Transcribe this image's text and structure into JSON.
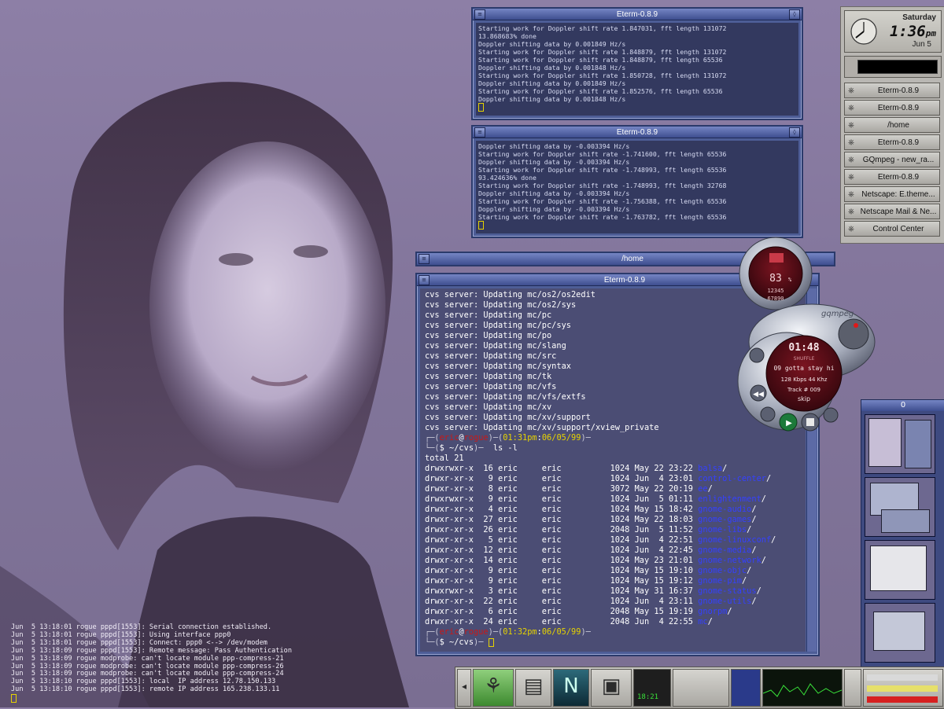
{
  "windows": {
    "eterm_top": {
      "title": "Eterm-0.8.9",
      "lines": [
        "Starting work for Doppler shift rate 1.847031, fft length 131072",
        "13.868683% done",
        "Doppler shifting data by 0.001849 Hz/s",
        "Starting work for Doppler shift rate 1.848879, fft length 131072",
        "Starting work for Doppler shift rate 1.848879, fft length 65536",
        "Doppler shifting data by 0.001848 Hz/s",
        "Starting work for Doppler shift rate 1.850728, fft length 131072",
        "Doppler shifting data by 0.001849 Hz/s",
        "Starting work for Doppler shift rate 1.852576, fft length 65536",
        "Doppler shifting data by 0.001848 Hz/s"
      ]
    },
    "eterm_mid": {
      "title": "Eterm-0.8.9",
      "lines": [
        "Doppler shifting data by -0.003394 Hz/s",
        "Starting work for Doppler shift rate -1.741600, fft length 65536",
        "Doppler shifting data by -0.003394 Hz/s",
        "Starting work for Doppler shift rate -1.748993, fft length 65536",
        "93.424636% done",
        "Starting work for Doppler shift rate -1.748993, fft length 32768",
        "Doppler shifting data by -0.003394 Hz/s",
        "Starting work for Doppler shift rate -1.756388, fft length 65536",
        "Doppler shifting data by -0.003394 Hz/s",
        "Starting work for Doppler shift rate -1.763782, fft length 65536"
      ]
    },
    "home_bar": {
      "title": "/home"
    },
    "eterm_main": {
      "title": "Eterm-0.8.9",
      "cvs_lines": [
        "cvs server: Updating mc/os2/os2edit",
        "cvs server: Updating mc/os2/sys",
        "cvs server: Updating mc/pc",
        "cvs server: Updating mc/pc/sys",
        "cvs server: Updating mc/po",
        "cvs server: Updating mc/slang",
        "cvs server: Updating mc/src",
        "cvs server: Updating mc/syntax",
        "cvs server: Updating mc/tk",
        "cvs server: Updating mc/vfs",
        "cvs server: Updating mc/vfs/extfs",
        "cvs server: Updating mc/xv",
        "cvs server: Updating mc/xv/support",
        "cvs server: Updating mc/xv/support/xview_private"
      ],
      "prompt1": {
        "user": "eric",
        "host": "rogue",
        "time": "01:31pm",
        "date": "06/05/99",
        "dir": "~/cvs",
        "cmd": "ls -l"
      },
      "total": "total 21",
      "listing": [
        {
          "perm": "drwxrwxr-x",
          "n": "16",
          "u": "eric",
          "g": "eric",
          "size": "1024",
          "date": "May 22 23:22",
          "name": "balsa"
        },
        {
          "perm": "drwxr-xr-x",
          "n": "9",
          "u": "eric",
          "g": "eric",
          "size": "1024",
          "date": "Jun  4 23:01",
          "name": "control-center"
        },
        {
          "perm": "drwxr-xr-x",
          "n": "8",
          "u": "eric",
          "g": "eric",
          "size": "3072",
          "date": "May 22 20:19",
          "name": "ee"
        },
        {
          "perm": "drwxrwxr-x",
          "n": "9",
          "u": "eric",
          "g": "eric",
          "size": "1024",
          "date": "Jun  5 01:11",
          "name": "enlightenment"
        },
        {
          "perm": "drwxr-xr-x",
          "n": "4",
          "u": "eric",
          "g": "eric",
          "size": "1024",
          "date": "May 15 18:42",
          "name": "gnome-audio"
        },
        {
          "perm": "drwxr-xr-x",
          "n": "27",
          "u": "eric",
          "g": "eric",
          "size": "1024",
          "date": "May 22 18:03",
          "name": "gnome-games"
        },
        {
          "perm": "drwxr-xr-x",
          "n": "26",
          "u": "eric",
          "g": "eric",
          "size": "2048",
          "date": "Jun  5 11:52",
          "name": "gnome-libs"
        },
        {
          "perm": "drwxr-xr-x",
          "n": "5",
          "u": "eric",
          "g": "eric",
          "size": "1024",
          "date": "Jun  4 22:51",
          "name": "gnome-linuxconf"
        },
        {
          "perm": "drwxr-xr-x",
          "n": "12",
          "u": "eric",
          "g": "eric",
          "size": "1024",
          "date": "Jun  4 22:45",
          "name": "gnome-media"
        },
        {
          "perm": "drwxr-xr-x",
          "n": "14",
          "u": "eric",
          "g": "eric",
          "size": "1024",
          "date": "May 23 21:01",
          "name": "gnome-network"
        },
        {
          "perm": "drwxr-xr-x",
          "n": "9",
          "u": "eric",
          "g": "eric",
          "size": "1024",
          "date": "May 15 19:10",
          "name": "gnome-objc"
        },
        {
          "perm": "drwxr-xr-x",
          "n": "9",
          "u": "eric",
          "g": "eric",
          "size": "1024",
          "date": "May 15 19:12",
          "name": "gnome-pim"
        },
        {
          "perm": "drwxrwxr-x",
          "n": "3",
          "u": "eric",
          "g": "eric",
          "size": "1024",
          "date": "May 31 16:37",
          "name": "gnome-status"
        },
        {
          "perm": "drwxr-xr-x",
          "n": "22",
          "u": "eric",
          "g": "eric",
          "size": "1024",
          "date": "Jun  4 23:11",
          "name": "gnome-utils"
        },
        {
          "perm": "drwxr-xr-x",
          "n": "6",
          "u": "eric",
          "g": "eric",
          "size": "2048",
          "date": "May 15 19:19",
          "name": "gnorpm"
        },
        {
          "perm": "drwxr-xr-x",
          "n": "24",
          "u": "eric",
          "g": "eric",
          "size": "2048",
          "date": "Jun  4 22:55",
          "name": "mc"
        }
      ],
      "prompt2": {
        "user": "eric",
        "host": "rogue",
        "time": "01:32pm",
        "date": "06/05/99",
        "dir": "~/cvs"
      }
    }
  },
  "syslog": [
    "Jun  5 13:18:01 rogue pppd[1553]: Serial connection established.",
    "Jun  5 13:18:01 rogue pppd[1553]: Using interface ppp0",
    "Jun  5 13:18:01 rogue pppd[1553]: Connect: ppp0 <--> /dev/modem",
    "Jun  5 13:18:09 rogue pppd[1553]: Remote message: Pass Authentication",
    "Jun  5 13:18:09 rogue modprobe: can't locate module ppp-compress-21",
    "Jun  5 13:18:09 rogue modprobe: can't locate module ppp-compress-26",
    "Jun  5 13:18:09 rogue modprobe: can't locate module ppp-compress-24",
    "Jun  5 13:18:10 rogue pppd[1553]: local  IP address 12.78.150.133",
    "Jun  5 13:18:10 rogue pppd[1553]: remote IP address 165.238.133.11"
  ],
  "clock": {
    "day": "Saturday",
    "time": "1:36",
    "ampm": "pm",
    "date": "Jun 5"
  },
  "tasks": [
    {
      "label": "Eterm-0.8.9"
    },
    {
      "label": "Eterm-0.8.9"
    },
    {
      "label": "/home"
    },
    {
      "label": "Eterm-0.8.9"
    },
    {
      "label": "GQmpeg - new_ra..."
    },
    {
      "label": "Eterm-0.8.9"
    },
    {
      "label": "Netscape: E.theme..."
    },
    {
      "label": "Netscape Mail & Ne..."
    },
    {
      "label": "Control Center"
    }
  ],
  "gqmpeg": {
    "volume": "83",
    "volume_unit": "%",
    "eq_row1": "12345",
    "eq_row2": "67890",
    "brand": "gqmpeg",
    "time": "01:48",
    "mode": "SHUFFLE",
    "song": "09 gotta stay hi",
    "bitrate": "128 Kbps 44 Khz",
    "track": "Track # 009",
    "skip": "skip"
  },
  "pager": {
    "label": "0"
  },
  "dock": {
    "clock": "18:21"
  },
  "colors": {
    "dir_blue": "#3440ff",
    "prompt_red": "#c81818",
    "prompt_yellow": "#e6d300",
    "window_blue": "#4d5d96"
  }
}
